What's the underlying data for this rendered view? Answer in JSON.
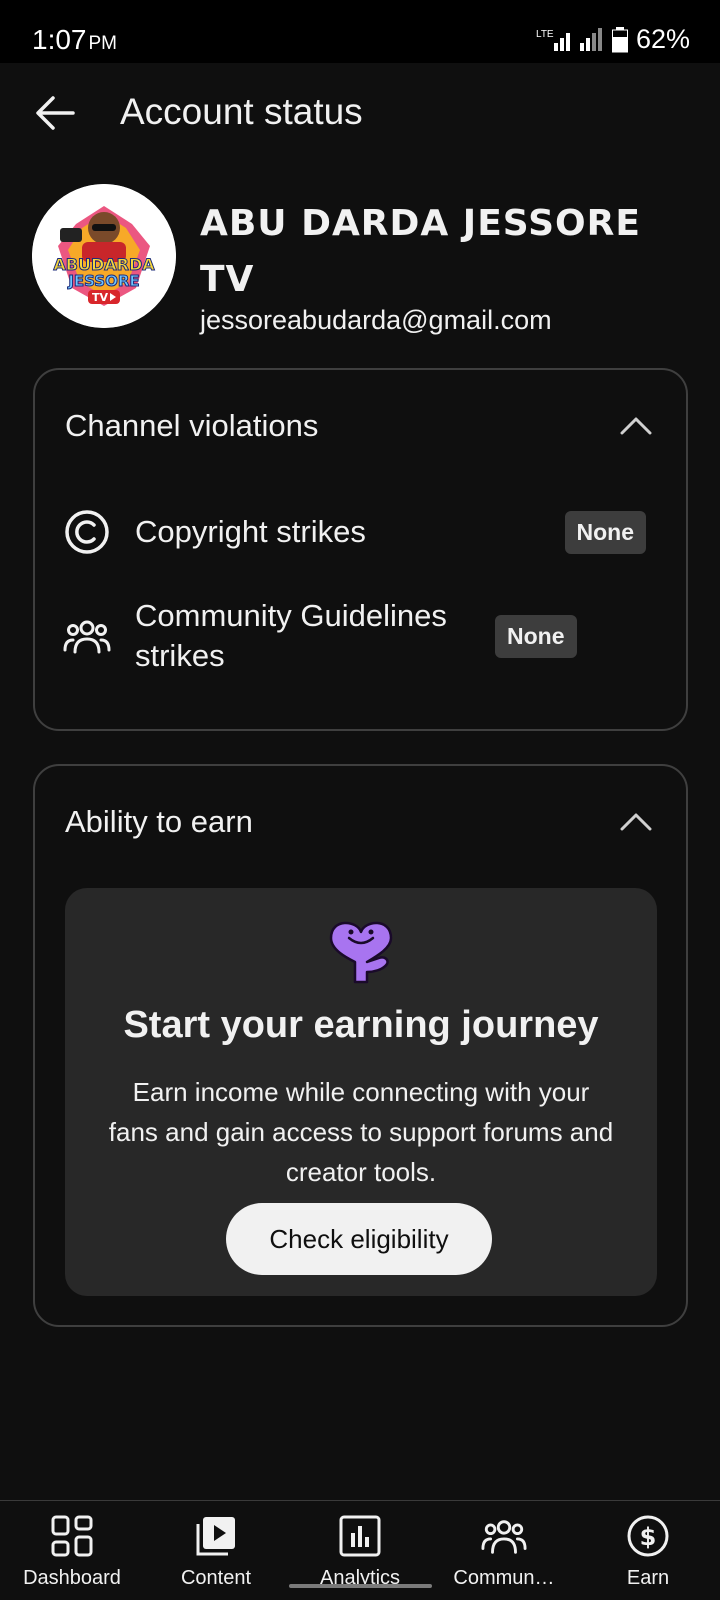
{
  "status_bar": {
    "time": "1:07",
    "ampm": "PM",
    "network": "LTE",
    "battery": "62%"
  },
  "header": {
    "title": "Account status",
    "back_icon": "arrow-left-icon"
  },
  "channel": {
    "name": "ABU DARDA JESSORE TV",
    "email": "jessoreabudarda@gmail.com",
    "avatar_text_line1": "ABUDARDA",
    "avatar_text_line2": "JESSORE",
    "avatar_text_line3": "TV"
  },
  "violations": {
    "title": "Channel violations",
    "items": [
      {
        "label": "Copyright strikes",
        "status": "None",
        "icon": "copyright-icon"
      },
      {
        "label": "Community Guidelines strikes",
        "status": "None",
        "icon": "community-icon"
      }
    ]
  },
  "earn": {
    "title": "Ability to earn",
    "heading": "Start your earning journey",
    "body": "Earn income while connecting with your fans and gain access to support forums and creator tools.",
    "button": "Check eligibility",
    "icon": "heart-creature-icon",
    "accent_color": "#b98cff"
  },
  "bottom_nav": [
    {
      "label": "Dashboard",
      "icon": "dashboard-icon"
    },
    {
      "label": "Content",
      "icon": "content-icon"
    },
    {
      "label": "Analytics",
      "icon": "analytics-icon",
      "selected": true
    },
    {
      "label": "Commun…",
      "icon": "community-icon"
    },
    {
      "label": "Earn",
      "icon": "dollar-icon"
    }
  ],
  "colors": {
    "background": "#0f0f0f",
    "card_border": "#3f3f3f",
    "panel": "#282828",
    "badge": "#3d3d3d",
    "text": "#f1f1f1"
  }
}
